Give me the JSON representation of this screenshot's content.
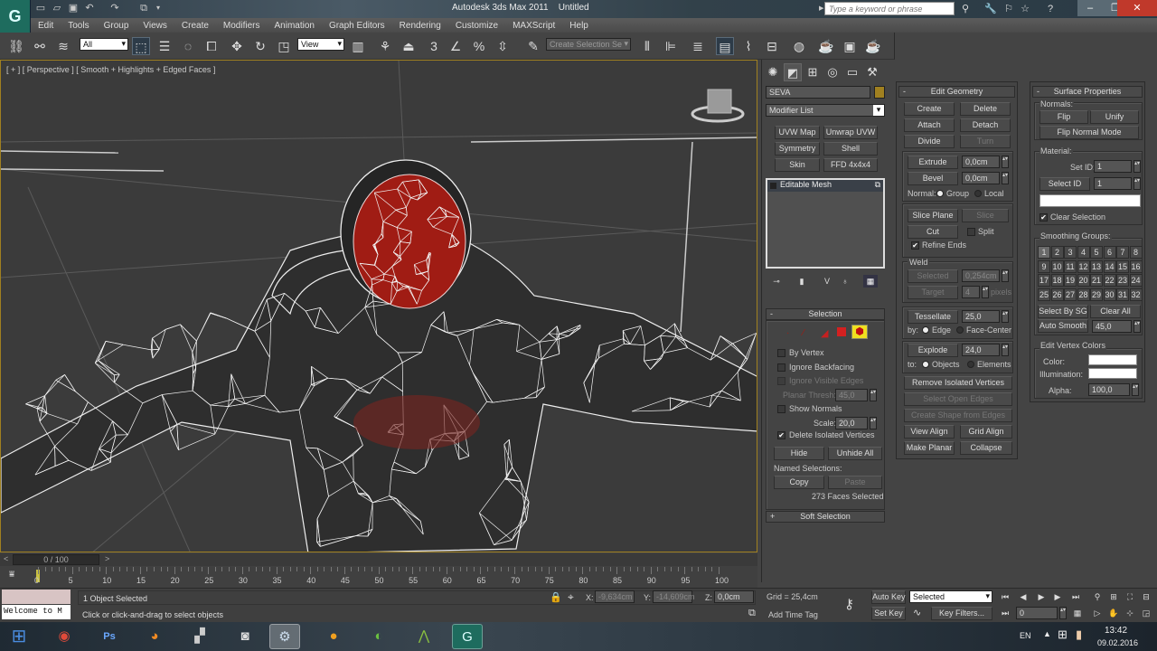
{
  "window": {
    "title": "Autodesk 3ds Max 2011",
    "document": "Untitled",
    "search_placeholder": "Type a keyword or phrase"
  },
  "menu": [
    "Edit",
    "Tools",
    "Group",
    "Views",
    "Create",
    "Modifiers",
    "Animation",
    "Graph Editors",
    "Rendering",
    "Customize",
    "MAXScript",
    "Help"
  ],
  "toolbar": {
    "selection_filter": "All",
    "ref_coord": "View",
    "named_selection_placeholder": "Create Selection Se",
    "snap_angle_label": "3"
  },
  "viewport": {
    "label": "[ + ] [ Perspective ] [ Smooth + Highlights + Edged Faces ]"
  },
  "command_panel": {
    "object_name": "SEVA",
    "object_color": "#a08020",
    "modifier_list": "Modifier List",
    "modifier_buttons": [
      "UVW Map",
      "Unwrap UVW",
      "Symmetry",
      "Shell",
      "Skin",
      "FFD 4x4x4"
    ],
    "stack_items": [
      "Editable Mesh"
    ],
    "selection": {
      "title": "Selection",
      "by_vertex": "By Vertex",
      "ignore_backfacing": "Ignore Backfacing",
      "ignore_visible_edges": "Ignore Visible Edges",
      "planar_thresh_label": "Planar Thresh:",
      "planar_thresh": "45,0",
      "show_normals": "Show Normals",
      "scale_label": "Scale:",
      "scale": "20,0",
      "delete_isolated": "Delete Isolated Vertices",
      "delete_isolated_checked": true,
      "hide": "Hide",
      "unhide_all": "Unhide All",
      "named_selections": "Named Selections:",
      "copy": "Copy",
      "paste": "Paste",
      "status": "273 Faces Selected"
    },
    "soft_selection": "Soft Selection"
  },
  "edit_geometry": {
    "title": "Edit Geometry",
    "create": "Create",
    "delete": "Delete",
    "attach": "Attach",
    "detach": "Detach",
    "divide": "Divide",
    "turn": "Turn",
    "extrude": "Extrude",
    "extrude_val": "0,0cm",
    "bevel": "Bevel",
    "bevel_val": "0,0cm",
    "normal_label": "Normal:",
    "group": "Group",
    "local": "Local",
    "slice_plane": "Slice Plane",
    "slice": "Slice",
    "cut": "Cut",
    "split": "Split",
    "refine_ends": "Refine Ends",
    "weld": "Weld",
    "selected": "Selected",
    "selected_val": "0,254cm",
    "target": "Target",
    "target_val": "4",
    "pixels": "pixels",
    "tessellate": "Tessellate",
    "tessellate_val": "25,0",
    "by_label": "by:",
    "edge": "Edge",
    "face_center": "Face-Center",
    "explode": "Explode",
    "explode_val": "24,0",
    "to_label": "to:",
    "objects": "Objects",
    "elements": "Elements",
    "remove_isolated": "Remove Isolated Vertices",
    "select_open_edges": "Select Open Edges",
    "create_shape": "Create Shape from Edges",
    "view_align": "View Align",
    "grid_align": "Grid Align",
    "make_planar": "Make Planar",
    "collapse": "Collapse"
  },
  "surface_properties": {
    "title": "Surface Properties",
    "normals": "Normals:",
    "flip": "Flip",
    "unify": "Unify",
    "flip_normal_mode": "Flip Normal Mode",
    "material": "Material:",
    "set_id_label": "Set ID:",
    "set_id": "1",
    "select_id": "Select ID",
    "select_id_val": "1",
    "clear_selection": "Clear Selection",
    "smoothing_groups": "Smoothing Groups:",
    "groups": [
      "1",
      "2",
      "3",
      "4",
      "5",
      "6",
      "7",
      "8",
      "9",
      "10",
      "11",
      "12",
      "13",
      "14",
      "15",
      "16",
      "17",
      "18",
      "19",
      "20",
      "21",
      "22",
      "23",
      "24",
      "25",
      "26",
      "27",
      "28",
      "29",
      "30",
      "31",
      "32"
    ],
    "active_group": "1",
    "select_by_sg": "Select By SG",
    "clear_all": "Clear All",
    "auto_smooth": "Auto Smooth",
    "auto_smooth_val": "45,0",
    "edit_vertex_colors": "Edit Vertex Colors",
    "color_label": "Color:",
    "illumination_label": "Illumination:",
    "alpha_label": "Alpha:",
    "alpha": "100,0"
  },
  "timeline": {
    "frame": "0 / 100",
    "ticks": [
      "0",
      "5",
      "10",
      "15",
      "20",
      "25",
      "30",
      "35",
      "40",
      "45",
      "50",
      "55",
      "60",
      "65",
      "70",
      "75",
      "80",
      "85",
      "90",
      "95",
      "100"
    ]
  },
  "status": {
    "maxscript_listener": "Welcome to M",
    "selected": "1 Object Selected",
    "prompt": "Click or click-and-drag to select objects",
    "x_label": "X:",
    "x": "-9,634cm",
    "y_label": "Y:",
    "y": "-14,609cm",
    "z_label": "Z:",
    "z": "0,0cm",
    "grid": "Grid = 25,4cm",
    "add_time_tag": "Add Time Tag",
    "auto_key": "Auto Key",
    "set_key": "Set Key",
    "key_mode": "Selected",
    "key_filters": "Key Filters...",
    "current_frame": "0"
  },
  "taskbar": {
    "apps": [
      "Start",
      "Chrome",
      "Photoshop",
      "Blender",
      "Movie Maker",
      "Camera App",
      "Steam",
      "Avast",
      "Internet Download Manager",
      "Notepad++",
      "3ds Max"
    ],
    "lang": "EN",
    "time": "13:42",
    "date": "09.02.2016"
  }
}
